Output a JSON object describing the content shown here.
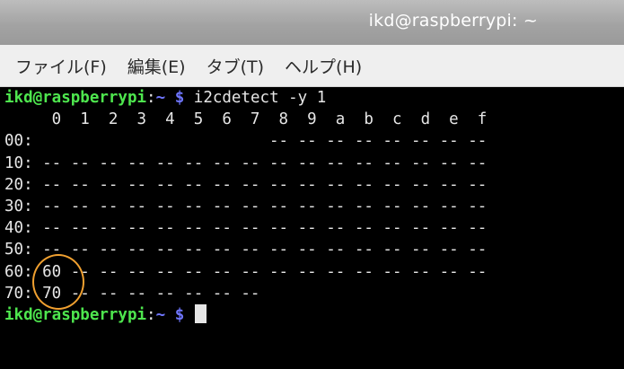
{
  "window": {
    "title": "ikd@raspberrypi: ~"
  },
  "menu": {
    "items": [
      {
        "label": "ファイル(F)"
      },
      {
        "label": "編集(E)"
      },
      {
        "label": "タブ(T)"
      },
      {
        "label": "ヘルプ(H)"
      }
    ]
  },
  "terminal": {
    "prompt": {
      "user_host": "ikd@raspberrypi",
      "colon": ":",
      "path": "~",
      "dollar": "$"
    },
    "command": "i2cdetect -y 1",
    "header_row": "     0  1  2  3  4  5  6  7  8  9  a  b  c  d  e  f",
    "rows": [
      "00:                         -- -- -- -- -- -- -- --",
      "10: -- -- -- -- -- -- -- -- -- -- -- -- -- -- -- --",
      "20: -- -- -- -- -- -- -- -- -- -- -- -- -- -- -- --",
      "30: -- -- -- -- -- -- -- -- -- -- -- -- -- -- -- --",
      "40: -- -- -- -- -- -- -- -- -- -- -- -- -- -- -- --",
      "50: -- -- -- -- -- -- -- -- -- -- -- -- -- -- -- --",
      "60: 60 -- -- -- -- -- -- -- -- -- -- -- -- -- -- --",
      "70: 70 -- -- -- -- -- -- --"
    ]
  },
  "colors": {
    "title_bar": "#a8a8a8",
    "menu_bar": "#efefef",
    "terminal_bg": "#000000",
    "prompt_user": "#4ee64e",
    "prompt_path": "#6f76ff",
    "highlight": "#f0a030"
  }
}
